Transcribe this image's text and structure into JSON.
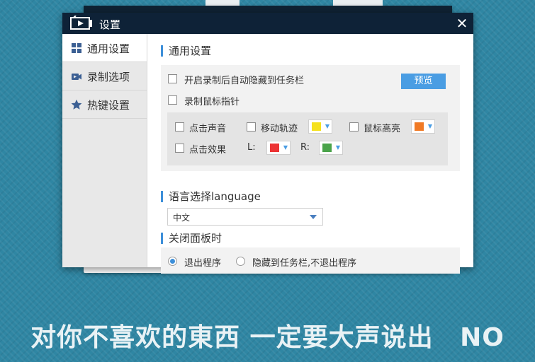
{
  "dialog": {
    "title": "设置",
    "close_label": "✕"
  },
  "sidebar": {
    "items": [
      {
        "label": "通用设置",
        "icon": "grid-icon",
        "active": true
      },
      {
        "label": "录制选项",
        "icon": "video-camera-icon",
        "active": false
      },
      {
        "label": "热键设置",
        "icon": "star-icon",
        "active": false
      }
    ]
  },
  "general": {
    "section_title": "通用设置",
    "auto_hide_label": "开启录制后自动隐藏到任务栏",
    "auto_hide_checked": false,
    "record_cursor_label": "录制鼠标指针",
    "record_cursor_checked": false,
    "preview_button": "预览",
    "click_sound_label": "点击声音",
    "move_trail_label": "移动轨迹",
    "move_trail_color": "#f5e11e",
    "cursor_highlight_label": "鼠标高亮",
    "cursor_highlight_color": "#f07a26",
    "click_effect_label": "点击效果",
    "left_label": "L:",
    "left_color": "#ec3334",
    "right_label": "R:",
    "right_color": "#4aa34a"
  },
  "language": {
    "section_title": "语言选择language",
    "selected": "中文"
  },
  "close_panel": {
    "section_title": "关闭面板时",
    "option_exit": "退出程序",
    "option_hide": "隐藏到任务栏,不退出程序",
    "selected": "exit"
  },
  "background": {
    "caption_main": "对你不喜欢的東西 一定要大声说出",
    "caption_end": "NO"
  },
  "colors": {
    "accent": "#3d8fd9",
    "titlebar": "#0e2237"
  }
}
